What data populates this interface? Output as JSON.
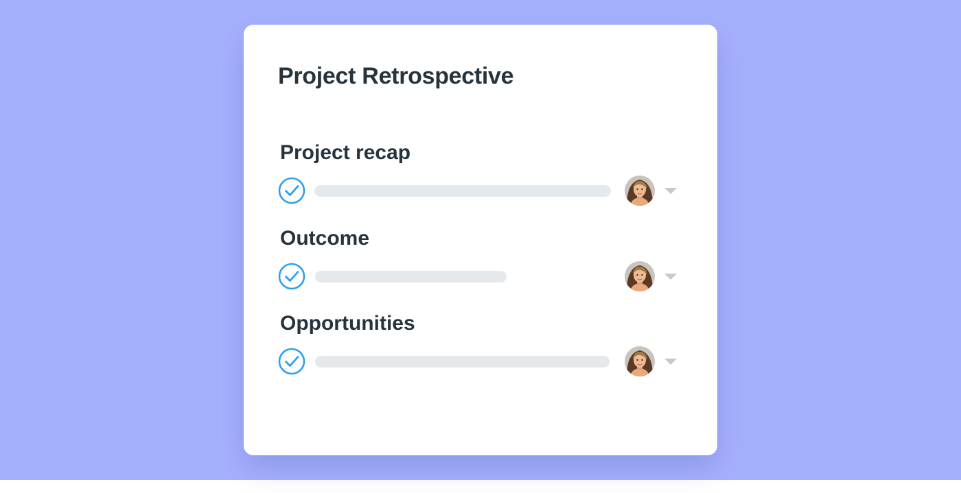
{
  "card": {
    "title": "Project Retrospective"
  },
  "sections": [
    {
      "heading": "Project recap",
      "completed": true,
      "bar_fill": 0.74,
      "assignee_icon": "avatar-woman",
      "menu_icon": "chevron-down-icon"
    },
    {
      "heading": "Outcome",
      "completed": true,
      "bar_fill": 0.47,
      "assignee_icon": "avatar-woman",
      "menu_icon": "chevron-down-icon"
    },
    {
      "heading": "Opportunities",
      "completed": true,
      "bar_fill": 0.74,
      "assignee_icon": "avatar-woman",
      "menu_icon": "chevron-down-icon"
    }
  ],
  "colors": {
    "background": "#a5b0fd",
    "card": "#ffffff",
    "heading_text": "#27343d",
    "check_accent": "#2d9ff0",
    "placeholder_bar": "#e6e9ec",
    "caret": "#c2c9cf"
  }
}
